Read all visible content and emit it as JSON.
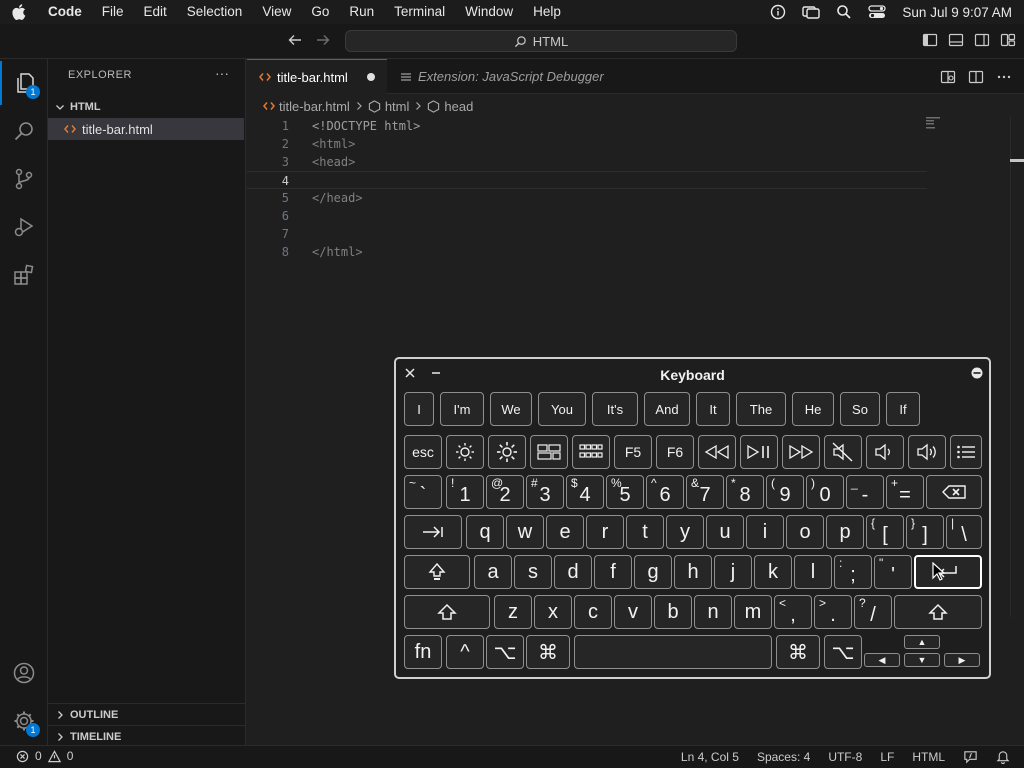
{
  "menubar": {
    "app": "Code",
    "items": [
      "File",
      "Edit",
      "Selection",
      "View",
      "Go",
      "Run",
      "Terminal",
      "Window",
      "Help"
    ],
    "clock": "Sun Jul 9  9:07 AM"
  },
  "titlebar": {
    "search": "HTML"
  },
  "activity": {
    "explorer_badge": "1",
    "manage_badge": "1"
  },
  "sidebar": {
    "header": "EXPLORER",
    "more": "···",
    "folder": "HTML",
    "file": "title-bar.html",
    "sections": [
      "OUTLINE",
      "TIMELINE"
    ]
  },
  "editor": {
    "tabs": [
      {
        "label": "title-bar.html",
        "modified": true
      },
      {
        "label": "Extension: JavaScript Debugger"
      }
    ],
    "breadcrumbs": [
      "title-bar.html",
      "html",
      "head"
    ],
    "lines": [
      {
        "num": "1",
        "text": "<!DOCTYPE html>"
      },
      {
        "num": "2",
        "text": "<html>"
      },
      {
        "num": "3",
        "text": "<head>"
      },
      {
        "num": "4",
        "text": ""
      },
      {
        "num": "5",
        "text": "</head>"
      },
      {
        "num": "6",
        "text": ""
      },
      {
        "num": "7",
        "text": ""
      },
      {
        "num": "8",
        "text": "</html>"
      }
    ]
  },
  "statusbar": {
    "errors": "0",
    "warnings": "0",
    "position": "Ln 4, Col 5",
    "spaces": "Spaces: 4",
    "encoding": "UTF-8",
    "eol": "LF",
    "language": "HTML"
  },
  "keyboard": {
    "title": "Keyboard",
    "suggestions": [
      "I",
      "I'm",
      "We",
      "You",
      "It's",
      "And",
      "It",
      "The",
      "He",
      "So",
      "If"
    ],
    "esc": "esc",
    "f5": "F5",
    "f6": "F6",
    "number_row": [
      {
        "up": "~",
        "main": "`"
      },
      {
        "up": "!",
        "main": "1"
      },
      {
        "up": "@",
        "main": "2"
      },
      {
        "up": "#",
        "main": "3"
      },
      {
        "up": "$",
        "main": "4"
      },
      {
        "up": "%",
        "main": "5"
      },
      {
        "up": "^",
        "main": "6"
      },
      {
        "up": "&",
        "main": "7"
      },
      {
        "up": "*",
        "main": "8"
      },
      {
        "up": "(",
        "main": "9"
      },
      {
        "up": ")",
        "main": "0"
      },
      {
        "up": "_",
        "main": "-"
      },
      {
        "up": "+",
        "main": "="
      }
    ],
    "row_q": [
      "q",
      "w",
      "e",
      "r",
      "t",
      "y",
      "u",
      "i",
      "o",
      "p"
    ],
    "row_q_sym": [
      {
        "up": "{",
        "main": "["
      },
      {
        "up": "}",
        "main": "]"
      },
      {
        "up": "|",
        "main": "\\"
      }
    ],
    "row_a": [
      "a",
      "s",
      "d",
      "f",
      "g",
      "h",
      "j",
      "k",
      "l"
    ],
    "row_a_sym": [
      {
        "up": ":",
        "main": ";"
      },
      {
        "up": "\"",
        "main": "'"
      }
    ],
    "row_z": [
      "z",
      "x",
      "c",
      "v",
      "b",
      "n",
      "m"
    ],
    "row_z_sym": [
      {
        "up": "<",
        "main": ","
      },
      {
        "up": ">",
        "main": "."
      },
      {
        "up": "?",
        "main": "/"
      }
    ],
    "fn": "fn",
    "control": "^",
    "option": "⌥",
    "command": "⌘"
  }
}
